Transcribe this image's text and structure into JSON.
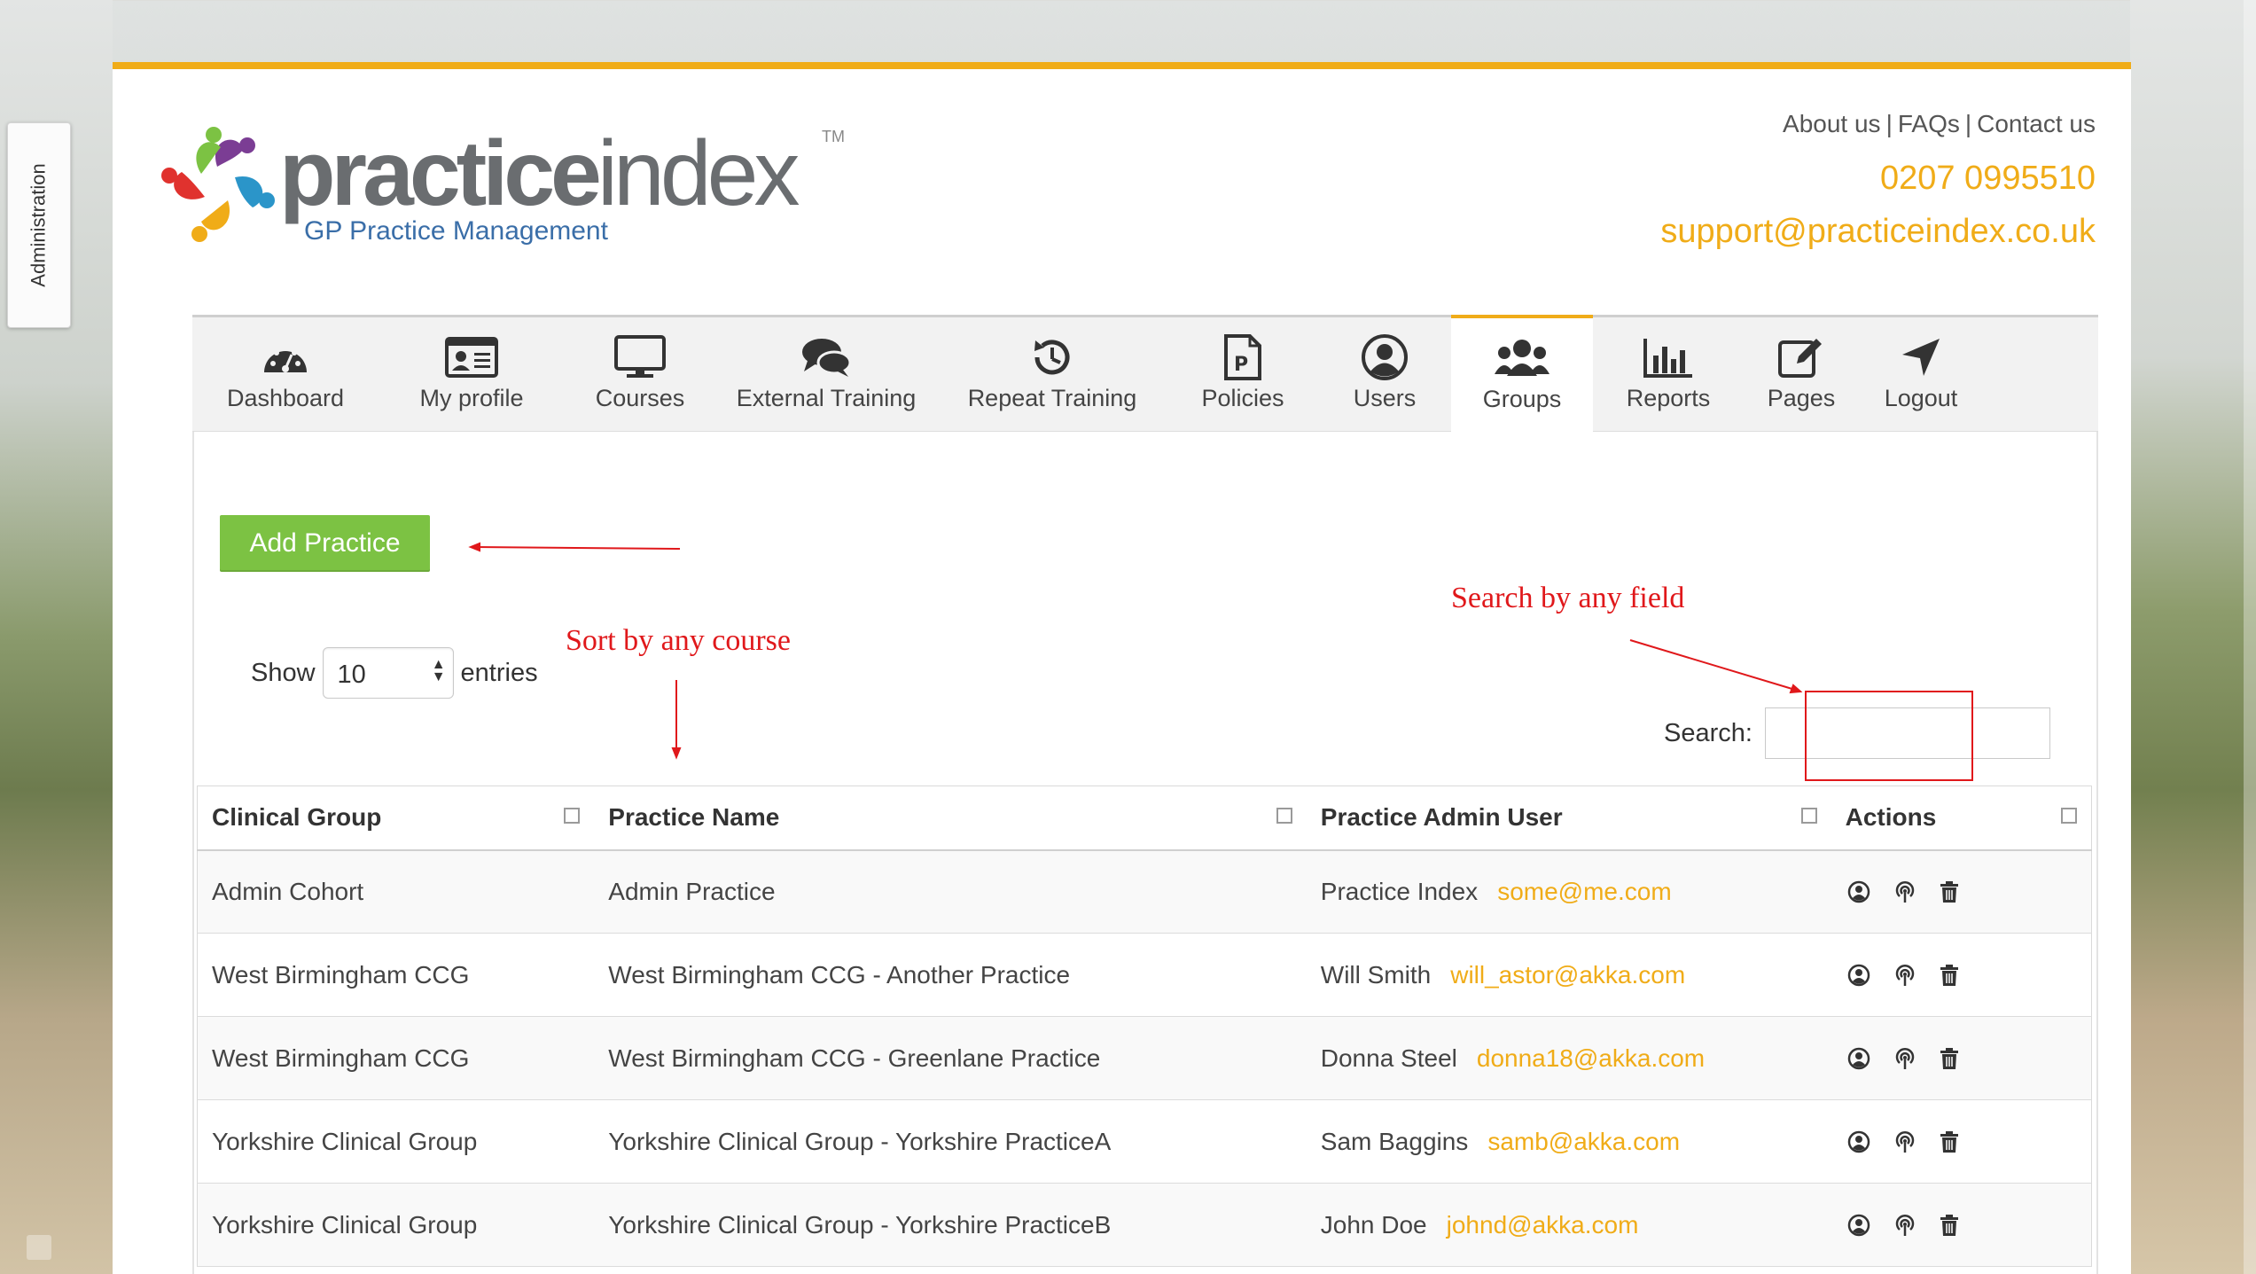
{
  "admin_tab": "Administration",
  "logo": {
    "brand_bold": "practice",
    "brand_light": "index",
    "tm": "TM",
    "tagline": "GP Practice Management"
  },
  "header": {
    "links": [
      "About us",
      "FAQs",
      "Contact us"
    ],
    "separator": "|",
    "phone": "0207 0995510",
    "email": "support@practiceindex.co.uk"
  },
  "nav": {
    "items": [
      {
        "label": "Dashboard",
        "icon": "dashboard-icon",
        "active": false
      },
      {
        "label": "My profile",
        "icon": "id-card-icon",
        "active": false
      },
      {
        "label": "Courses",
        "icon": "monitor-icon",
        "active": false
      },
      {
        "label": "External Training",
        "icon": "comments-icon",
        "active": false
      },
      {
        "label": "Repeat Training",
        "icon": "history-icon",
        "active": false
      },
      {
        "label": "Policies",
        "icon": "document-p-icon",
        "active": false
      },
      {
        "label": "Users",
        "icon": "user-circle-icon",
        "active": false
      },
      {
        "label": "Groups",
        "icon": "users-group-icon",
        "active": true
      },
      {
        "label": "Reports",
        "icon": "bar-chart-icon",
        "active": false
      },
      {
        "label": "Pages",
        "icon": "edit-icon",
        "active": false
      },
      {
        "label": "Logout",
        "icon": "location-arrow-icon",
        "active": false
      }
    ]
  },
  "add_button": "Add Practice",
  "table_controls": {
    "show_label": "Show",
    "entries_value": "10",
    "entries_label": "entries",
    "search_label": "Search:",
    "search_value": ""
  },
  "annotations": {
    "sort": "Sort by any course",
    "search": "Search by any field"
  },
  "table": {
    "columns": [
      "Clinical Group",
      "Practice Name",
      "Practice Admin User",
      "Actions"
    ],
    "rows": [
      {
        "group": "Admin Cohort",
        "practice": "Admin Practice",
        "admin_name": "Practice Index",
        "admin_email": "some@me.com"
      },
      {
        "group": "West Birmingham CCG",
        "practice": "West Birmingham CCG - Another Practice",
        "admin_name": "Will Smith",
        "admin_email": "will_astor@akka.com"
      },
      {
        "group": "West Birmingham CCG",
        "practice": "West Birmingham CCG - Greenlane Practice",
        "admin_name": "Donna Steel",
        "admin_email": "donna18@akka.com"
      },
      {
        "group": "Yorkshire Clinical Group",
        "practice": "Yorkshire Clinical Group - Yorkshire PracticeA",
        "admin_name": "Sam Baggins",
        "admin_email": "samb@akka.com"
      },
      {
        "group": "Yorkshire Clinical Group",
        "practice": "Yorkshire Clinical Group - Yorkshire PracticeB",
        "admin_name": "John Doe",
        "admin_email": "johnd@akka.com"
      }
    ],
    "row_actions": [
      "view-user-icon",
      "broadcast-icon",
      "trash-icon"
    ]
  },
  "colors": {
    "accent": "#f0ac18",
    "button_green": "#7cc243",
    "annotation_red": "#e0181b"
  }
}
